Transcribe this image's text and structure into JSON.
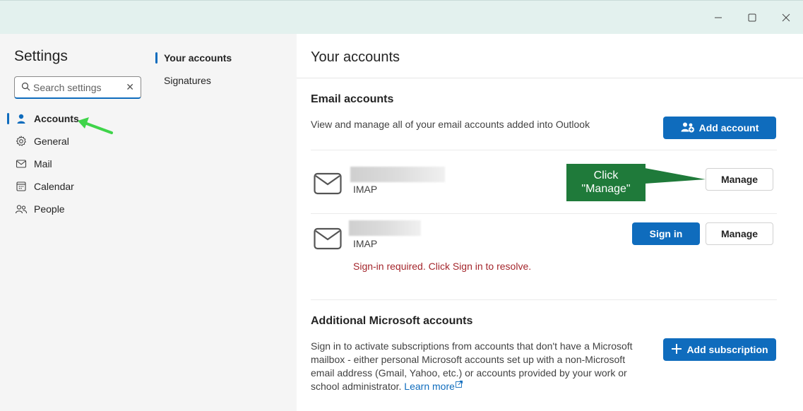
{
  "window": {
    "minimize_icon": "minimize-icon",
    "maximize_icon": "maximize-icon",
    "close_icon": "close-icon"
  },
  "sidebar": {
    "title": "Settings",
    "search": {
      "placeholder": "Search settings",
      "value": ""
    },
    "items": [
      {
        "label": "Accounts",
        "icon": "person-icon",
        "active": true
      },
      {
        "label": "General",
        "icon": "gear-icon",
        "active": false
      },
      {
        "label": "Mail",
        "icon": "mail-icon",
        "active": false
      },
      {
        "label": "Calendar",
        "icon": "calendar-icon",
        "active": false
      },
      {
        "label": "People",
        "icon": "people-icon",
        "active": false
      }
    ]
  },
  "subnav": {
    "items": [
      {
        "label": "Your accounts",
        "active": true
      },
      {
        "label": "Signatures",
        "active": false
      }
    ]
  },
  "main": {
    "title": "Your accounts",
    "email_accounts": {
      "heading": "Email accounts",
      "description": "View and manage all of your email accounts added into Outlook",
      "add_button": "Add account",
      "accounts": [
        {
          "type": "IMAP",
          "manage_label": "Manage",
          "error": ""
        },
        {
          "type": "IMAP",
          "manage_label": "Manage",
          "sign_in_label": "Sign in",
          "error": "Sign-in required. Click Sign in to resolve."
        }
      ]
    },
    "additional": {
      "heading": "Additional Microsoft accounts",
      "description": "Sign in to activate subscriptions from accounts that don't have a Microsoft mailbox - either personal Microsoft accounts set up with a non-Microsoft email address (Gmail, Yahoo, etc.) or accounts provided by your work or school administrator.",
      "learn_more": "Learn more",
      "add_button": "Add subscription"
    }
  },
  "annotation": {
    "callout_line1": "Click",
    "callout_line2": "\"Manage\"",
    "callout_color": "#1f7a3a",
    "arrow_color": "#3fd44a"
  },
  "colors": {
    "accent": "#0f6cbd",
    "error": "#a4262c",
    "titlebar": "#e3f1ee"
  }
}
